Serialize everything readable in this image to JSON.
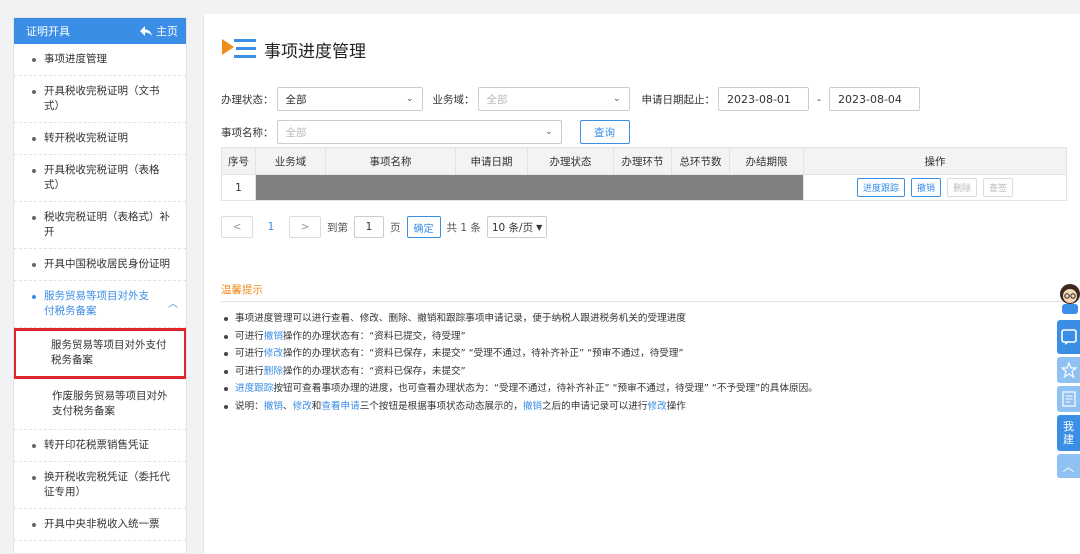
{
  "sidebar": {
    "header": "证明开具",
    "home": "主页",
    "items": [
      {
        "label": "事项进度管理"
      },
      {
        "label": "开具税收完税证明（文书式）"
      },
      {
        "label": "转开税收完税证明"
      },
      {
        "label": "开具税收完税证明（表格式）"
      },
      {
        "label": "税收完税证明（表格式）补开"
      },
      {
        "label": "开具中国税收居民身份证明"
      },
      {
        "label": "服务贸易等项目对外支付税务备案"
      }
    ],
    "sub_items": [
      {
        "label": "服务贸易等项目对外支付税务备案"
      },
      {
        "label": "作废服务贸易等项目对外支付税务备案"
      }
    ],
    "items_after": [
      {
        "label": "转开印花税票销售凭证"
      },
      {
        "label": "换开税收完税凭证（委托代征专用）"
      },
      {
        "label": "开具中央非税收入统一票"
      }
    ]
  },
  "page": {
    "title": "事项进度管理"
  },
  "filters": {
    "status_label": "办理状态：",
    "status_value": "全部",
    "domain_label": "业务域：",
    "domain_value": "全部",
    "date_label": "申请日期起止：",
    "date_from": "2023-08-01",
    "date_sep": "-",
    "date_to": "2023-08-04",
    "name_label": "事项名称：",
    "name_value": "全部",
    "query_button": "查询"
  },
  "table": {
    "headers": [
      "序号",
      "业务域",
      "事项名称",
      "申请日期",
      "办理状态",
      "办理环节",
      "总环节数",
      "办结期限",
      "操作"
    ],
    "rows": [
      {
        "index": "1",
        "actions": [
          "进度跟踪",
          "撤销",
          "删除",
          "查签"
        ]
      }
    ]
  },
  "pager": {
    "current": "1",
    "goto_label": "到第",
    "goto_value": "1",
    "page_unit": "页",
    "confirm": "确定",
    "total": "共 1 条",
    "page_size": "10 条/页"
  },
  "tips": {
    "title": "温馨提示",
    "lines": [
      {
        "pre": "事项进度管理可以进行查看、修改、删除、撤销和跟踪事项申请记录，便于纳税人跟进税务机关的受理进度"
      },
      {
        "pre": "可进行",
        "link": "撤销",
        "post": "操作的办理状态有：“资料已提交，待受理”"
      },
      {
        "pre": "可进行",
        "link": "修改",
        "post": "操作的办理状态有：“资料已保存，未提交”  “受理不通过，待补齐补正”  “预审不通过，待受理”"
      },
      {
        "pre": "可进行",
        "link": "删除",
        "post": "操作的办理状态有：“资料已保存，未提交”"
      },
      {
        "link": "进度跟踪",
        "post": "按钮可查看事项办理的进度，也可查看办理状态为：“受理不通过，待补齐补正”  “预审不通过，待受理”  “不予受理”的具体原因。"
      }
    ],
    "last": {
      "p1": "说明：",
      "l1": "撤销",
      "p2": "、",
      "l2": "修改",
      "p3": "和",
      "l3": "查看申请",
      "p4": "三个按钮是根据事项状态动态展示的，",
      "l4": "撤销",
      "p5": "之后的申请记录可以进行",
      "l5": "修改",
      "p6": "操作"
    }
  },
  "floatbar": {
    "labels": [
      "我",
      "建"
    ]
  },
  "colors": {
    "accent": "#3a8ee6",
    "highlight": "#e0242b",
    "tip": "#f08c1a",
    "redacted": "#808080"
  }
}
